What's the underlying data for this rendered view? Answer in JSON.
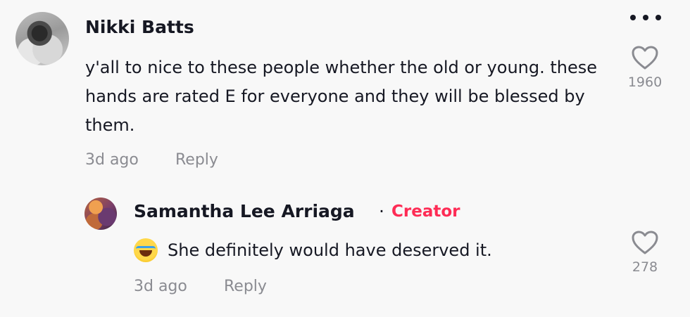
{
  "comment": {
    "username": "Nikki Batts",
    "text": "y'all to nice to these people whether the old or young. these hands are rated E for everyone and they will be blessed by them.",
    "time": "3d ago",
    "reply_label": "Reply",
    "like_count": "1960"
  },
  "reply": {
    "username": "Samantha Lee Arriaga",
    "separator": "·",
    "badge": "Creator",
    "emoji": "face-with-tears-of-joy",
    "text": "She definitely would have deserved it.",
    "time": "3d ago",
    "reply_label": "Reply",
    "like_count": "278"
  },
  "colors": {
    "background": "#f8f8f8",
    "text_primary": "#161823",
    "text_secondary": "#8a8b91",
    "creator_badge": "#fe2c55"
  },
  "icons": {
    "more": "more-horizontal-icon",
    "like": "heart-outline-icon"
  }
}
